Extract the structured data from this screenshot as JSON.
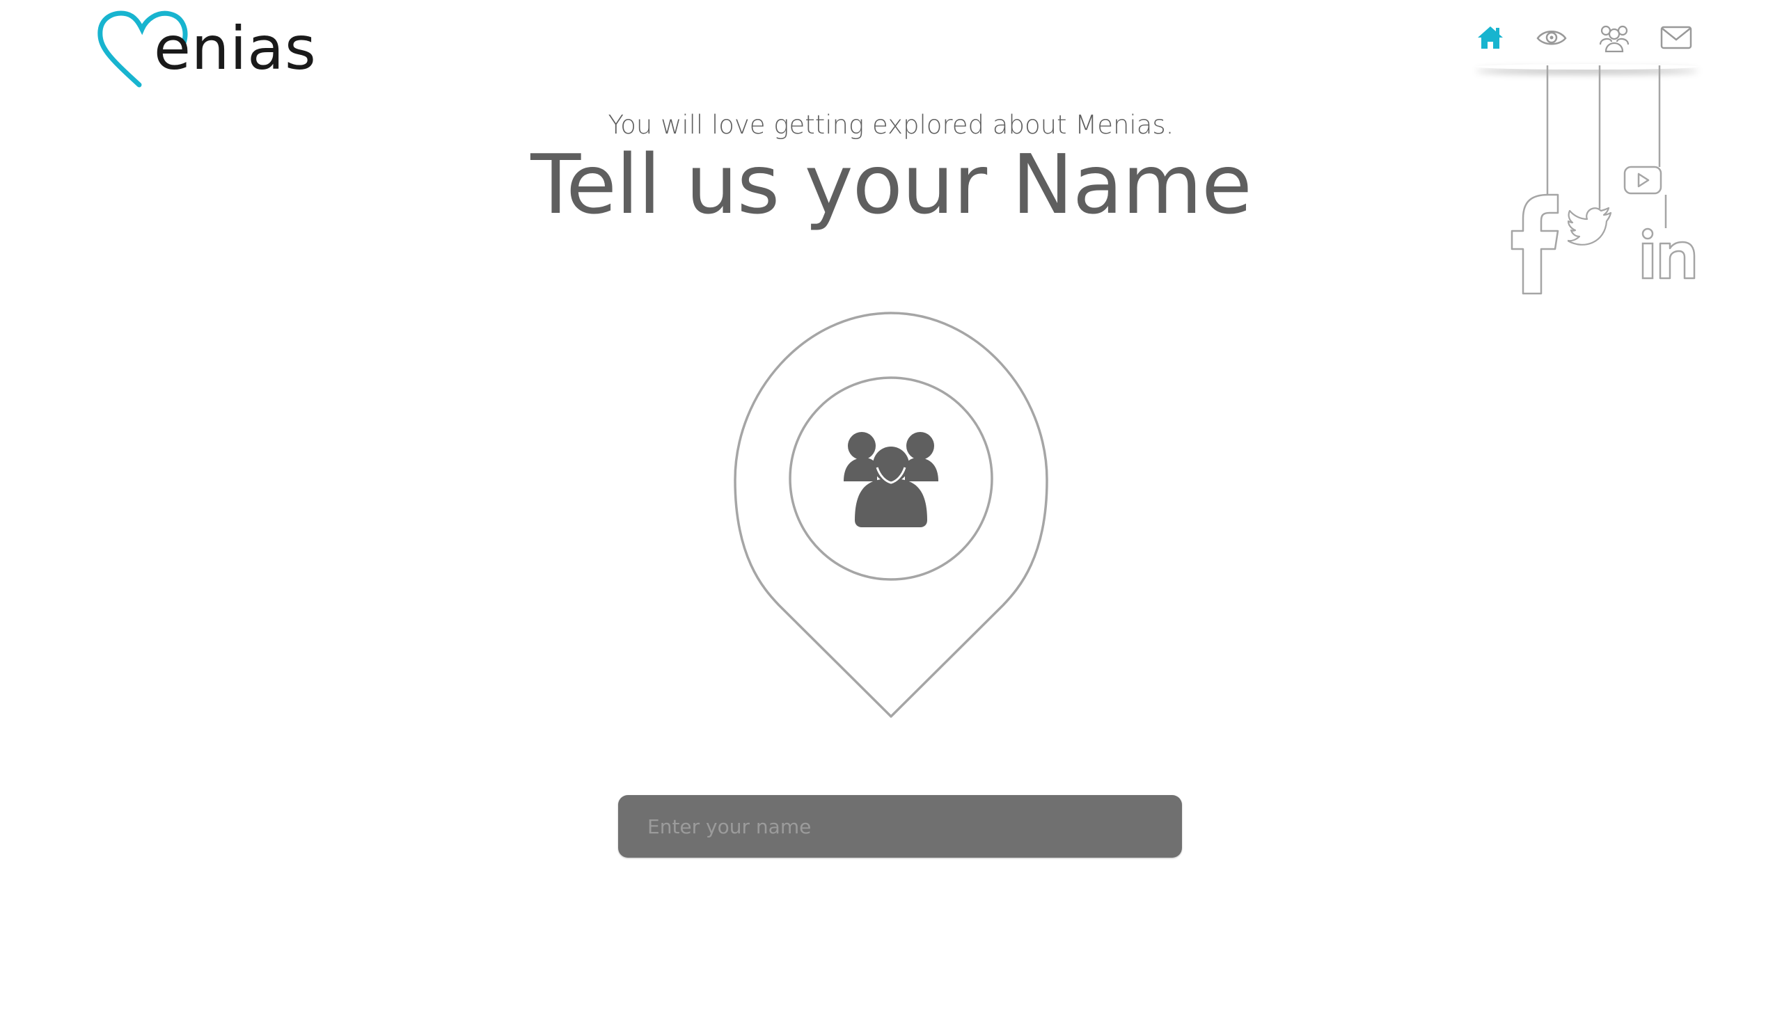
{
  "brand": {
    "logo_text": "enias",
    "accent_color": "#18b4cf"
  },
  "nav": {
    "items": [
      {
        "icon": "home-icon",
        "active": true
      },
      {
        "icon": "eye-icon",
        "active": false
      },
      {
        "icon": "group-icon",
        "active": false
      },
      {
        "icon": "mail-icon",
        "active": false
      }
    ]
  },
  "social": {
    "icons": [
      "facebook-icon",
      "twitter-icon",
      "youtube-icon",
      "linkedin-icon"
    ]
  },
  "hero": {
    "subtitle": "You will love getting explored about Menias.",
    "title": "Tell us your Name"
  },
  "form": {
    "name_placeholder": "Enter your name",
    "name_value": ""
  },
  "colors": {
    "text": "#5f5f5f",
    "input_bg": "#707070",
    "outline": "#a5a5a5"
  }
}
